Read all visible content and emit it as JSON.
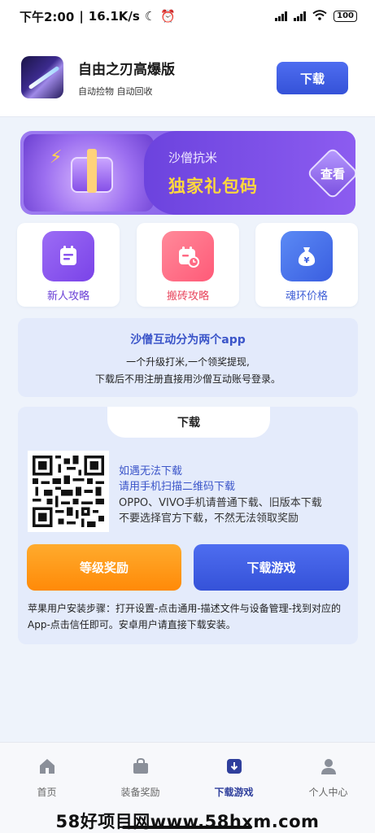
{
  "status_bar": {
    "time": "下午2:00",
    "speed": "16.1K/s",
    "battery": "100"
  },
  "header": {
    "title": "自由之刃高爆版",
    "tags": "自动捡物  自动回收",
    "download_label": "下载"
  },
  "banner": {
    "subtitle": "沙僧抗米",
    "title": "独家礼包码",
    "view_label": "查看"
  },
  "features": [
    {
      "label": "新人攻略",
      "icon": "notebook-icon",
      "color": "#7a43e8"
    },
    {
      "label": "搬砖攻略",
      "icon": "calendar-icon",
      "color": "#ff5a78"
    },
    {
      "label": "魂环价格",
      "icon": "money-bag-icon",
      "color": "#3a5ee0"
    }
  ],
  "info": {
    "title": "沙僧互动分为两个app",
    "line1": "一个升级打米,一个领奖提现,",
    "line2": "下载后不用注册直接用沙僧互动账号登录。"
  },
  "download_section": {
    "tab_label": "下载",
    "qr_line1": "如遇无法下载",
    "qr_line2": "请用手机扫描二维码下载",
    "qr_line3": "OPPO、VIVO手机请普通下载、旧版本下载",
    "qr_line4": "不要选择官方下载，不然无法领取奖励",
    "level_reward_label": "等级奖励",
    "download_game_label": "下载游戏",
    "ios_note": "苹果用户安装步骤：打开设置-点击通用-描述文件与设备管理-找到对应的App-点击信任即可。安卓用户请直接下载安装。"
  },
  "bottom_nav": [
    {
      "label": "首页",
      "icon": "home-icon"
    },
    {
      "label": "装备奖励",
      "icon": "bag-icon"
    },
    {
      "label": "下载游戏",
      "icon": "download-box-icon",
      "active": true
    },
    {
      "label": "个人中心",
      "icon": "user-icon"
    }
  ],
  "watermark": "58好项目网www.58hxm.com",
  "colors": {
    "primary_blue": "#3552d8",
    "orange": "#ff8a08",
    "purple": "#7a52e6",
    "gold_text": "#ffd83d"
  }
}
